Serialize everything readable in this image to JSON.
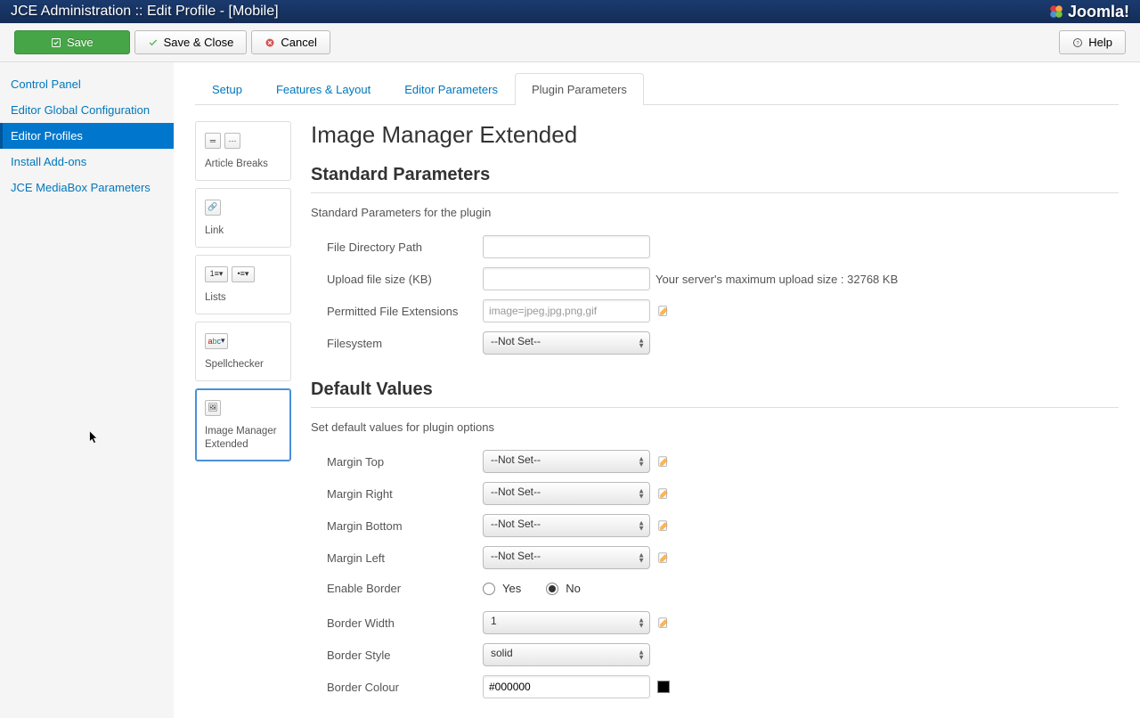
{
  "header": {
    "title": "JCE Administration :: Edit Profile - [Mobile]",
    "logo_text": "Joomla!"
  },
  "toolbar": {
    "save_label": "Save",
    "save_close_label": "Save & Close",
    "cancel_label": "Cancel",
    "help_label": "Help"
  },
  "sidebar": {
    "items": [
      "Control Panel",
      "Editor Global Configuration",
      "Editor Profiles",
      "Install Add-ons",
      "JCE MediaBox Parameters"
    ],
    "active_index": 2
  },
  "tabs": {
    "items": [
      "Setup",
      "Features & Layout",
      "Editor Parameters",
      "Plugin Parameters"
    ],
    "active_index": 3
  },
  "plugin_list": [
    {
      "label": "Article Breaks"
    },
    {
      "label": "Link"
    },
    {
      "label": "Lists"
    },
    {
      "label": "Spellchecker"
    },
    {
      "label": "Image Manager Extended"
    }
  ],
  "plugin_selected_index": 4,
  "settings": {
    "title": "Image Manager Extended",
    "standard": {
      "heading": "Standard Parameters",
      "desc": "Standard Parameters for the plugin",
      "file_dir_label": "File Directory Path",
      "file_dir_value": "",
      "upload_size_label": "Upload file size (KB)",
      "upload_size_value": "",
      "upload_size_hint": "Your server's maximum upload size : 32768 KB",
      "permitted_ext_label": "Permitted File Extensions",
      "permitted_ext_placeholder": "image=jpeg,jpg,png,gif",
      "filesystem_label": "Filesystem",
      "filesystem_value": "--Not Set--"
    },
    "defaults": {
      "heading": "Default Values",
      "desc": "Set default values for plugin options",
      "margin_top_label": "Margin Top",
      "margin_top_value": "--Not Set--",
      "margin_right_label": "Margin Right",
      "margin_right_value": "--Not Set--",
      "margin_bottom_label": "Margin Bottom",
      "margin_bottom_value": "--Not Set--",
      "margin_left_label": "Margin Left",
      "margin_left_value": "--Not Set--",
      "enable_border_label": "Enable Border",
      "enable_border_yes": "Yes",
      "enable_border_no": "No",
      "enable_border_value": "No",
      "border_width_label": "Border Width",
      "border_width_value": "1",
      "border_style_label": "Border Style",
      "border_style_value": "solid",
      "border_colour_label": "Border Colour",
      "border_colour_value": "#000000"
    }
  }
}
